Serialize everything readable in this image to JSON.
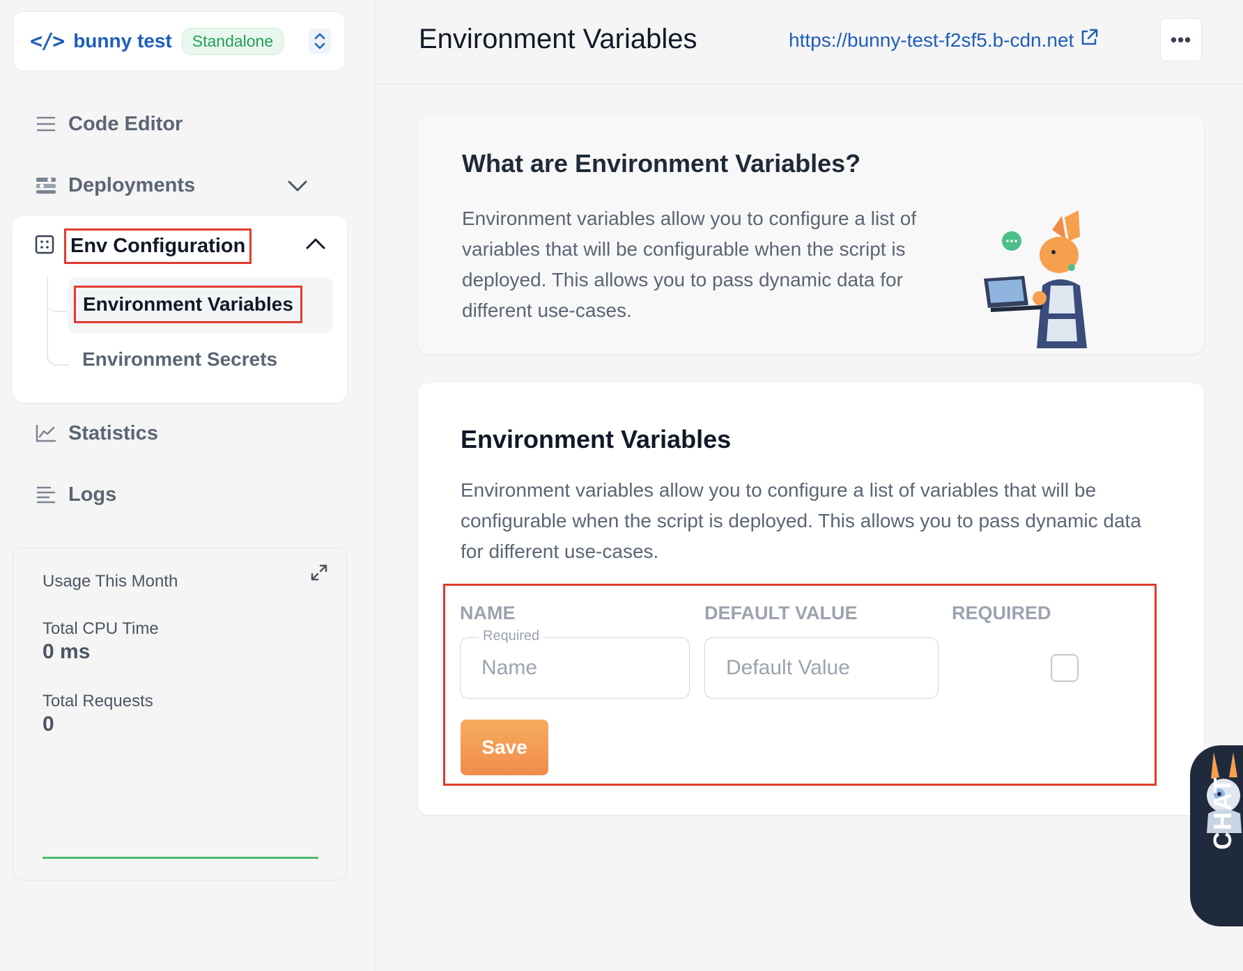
{
  "app": {
    "name": "bunny test",
    "badge": "Standalone"
  },
  "sidebar": {
    "items": [
      {
        "label": "Code Editor",
        "icon": "lines-icon"
      },
      {
        "label": "Deployments",
        "icon": "sliders-icon"
      },
      {
        "label": "Env Configuration",
        "icon": "grid-icon"
      },
      {
        "label": "Statistics",
        "icon": "chart-line-icon"
      },
      {
        "label": "Logs",
        "icon": "list-icon"
      }
    ],
    "env_sub_items": [
      {
        "label": "Environment Variables",
        "active": true
      },
      {
        "label": "Environment Secrets",
        "active": false
      }
    ]
  },
  "usage": {
    "title": "Usage This Month",
    "cpu_label": "Total CPU Time",
    "cpu_value": "0 ms",
    "requests_label": "Total Requests",
    "requests_value": "0"
  },
  "header": {
    "title": "Environment Variables",
    "link": "https://bunny-test-f2sf5.b-cdn.net",
    "more": "•••"
  },
  "info_card": {
    "title": "What are Environment Variables?",
    "text": "Environment variables allow you to configure a list of variables that will be configurable when the script is deployed. This allows you to pass dynamic data for different use-cases."
  },
  "env_card": {
    "title": "Environment Variables",
    "text": "Environment variables allow you to configure a list of variables that will be configurable when the script is deployed. This allows you to pass dynamic data for different use-cases.",
    "columns": [
      "NAME",
      "DEFAULT VALUE",
      "REQUIRED"
    ],
    "name_float_label": "Required",
    "name_placeholder": "Name",
    "default_placeholder": "Default Value",
    "required_checked": false,
    "save_label": "Save"
  },
  "chat": {
    "label": "CHAT"
  },
  "colors": {
    "brand_blue": "#1e5eb8",
    "badge_green": "#22a054",
    "highlight_red": "#e03b2e",
    "save_orange": "#f08c4a"
  }
}
